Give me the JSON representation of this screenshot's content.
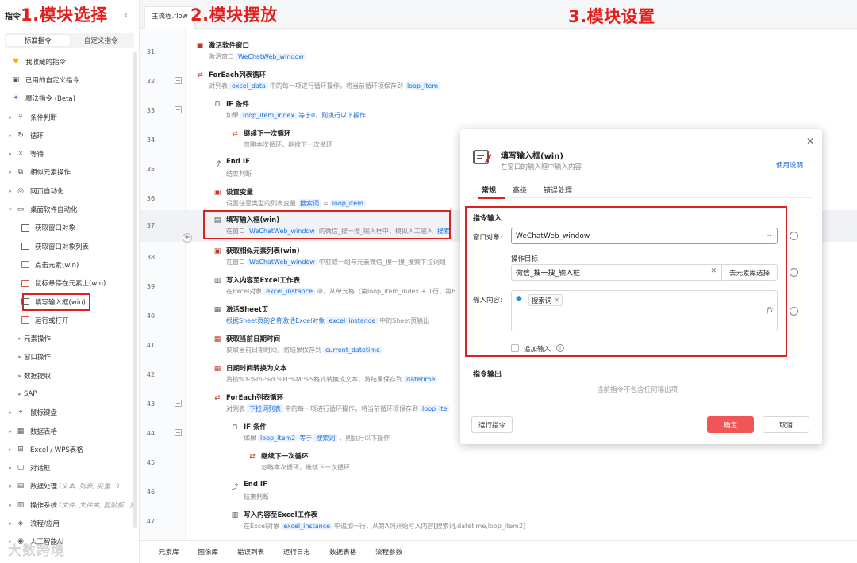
{
  "annotations": {
    "a1": "1.模块选择",
    "a2": "2.模块摆放",
    "a3": "3.模块设置"
  },
  "sidebar": {
    "title": "指令",
    "tabs": [
      "标准指令",
      "自定义指令"
    ],
    "items": [
      {
        "label": "我收藏的指令",
        "icon": "heart-icon"
      },
      {
        "label": "已用的自定义指令",
        "icon": "box-icon"
      },
      {
        "label": "魔法指令 (Beta)",
        "icon": "magic-icon"
      },
      {
        "label": "条件判断",
        "icon": "branch-icon"
      },
      {
        "label": "循环",
        "icon": "loop-icon"
      },
      {
        "label": "等待",
        "icon": "hourglass-icon"
      },
      {
        "label": "相似元素操作",
        "icon": "copy-icon"
      },
      {
        "label": "网页自动化",
        "icon": "globe-icon"
      },
      {
        "label": "桌面软件自动化",
        "icon": "monitor-icon"
      },
      {
        "label": "获取窗口对象",
        "icon": "window-icon"
      },
      {
        "label": "获取窗口对象列表",
        "icon": "window-list-icon"
      },
      {
        "label": "点击元素(win)",
        "icon": "click-icon"
      },
      {
        "label": "鼠标悬停在元素上(win)",
        "icon": "hover-icon"
      },
      {
        "label": "填写输入框(win)",
        "icon": "input-icon"
      },
      {
        "label": "运行或打开",
        "icon": "run-icon"
      },
      {
        "label": "元素操作",
        "icon": ""
      },
      {
        "label": "窗口操作",
        "icon": ""
      },
      {
        "label": "数据提取",
        "icon": ""
      },
      {
        "label": "SAP",
        "icon": ""
      },
      {
        "label": "鼠标键盘",
        "icon": "mouse-icon"
      },
      {
        "label": "数据表格",
        "icon": "table-icon"
      },
      {
        "label": "Excel / WPS表格",
        "icon": "excel-icon"
      },
      {
        "label": "对话框",
        "icon": "dialog-icon"
      },
      {
        "label": "数据处理",
        "hint": "(文本, 列表, 变量...)",
        "icon": "data-icon"
      },
      {
        "label": "操作系统",
        "hint": "(文件, 文件夹, 剪贴板...)",
        "icon": "os-icon"
      },
      {
        "label": "流程/应用",
        "icon": "flow-icon"
      },
      {
        "label": "人工智能AI",
        "icon": "ai-icon"
      }
    ]
  },
  "main": {
    "file_tab": "主流程.flow",
    "rows": [
      {
        "ln": "31",
        "title": "激活软件窗口",
        "desc_pre": "激活窗口",
        "v1": "WeChatWeb_window"
      },
      {
        "ln": "32",
        "title": "ForEach列表循环",
        "desc_pre": "对列表",
        "v1": "excel_data",
        "desc_mid": "中的每一项进行循环操作，将当前循环项保存到",
        "v2": "loop_item"
      },
      {
        "ln": "33",
        "title": "IF 条件",
        "desc_pre": "如果",
        "v1": "loop_item_index",
        "desc_mid": "等于0，则执行以下操作"
      },
      {
        "ln": "34",
        "title": "继续下一次循环",
        "desc_pre": "忽略本次循环，继续下一次循环"
      },
      {
        "ln": "35",
        "title": "End IF",
        "desc_pre": "结束判断"
      },
      {
        "ln": "36",
        "title": "设置变量",
        "desc_pre": "设置任意类型的列表变量",
        "v1": "搜索词",
        "desc_mid": "=",
        "v2": "loop_item"
      },
      {
        "ln": "37",
        "title": "填写输入框(win)",
        "desc_pre": "在窗口",
        "v1": "WeChatWeb_window",
        "desc_mid": "的微信_搜一搜_输入框中，模拟人工输入",
        "v2": "搜索"
      },
      {
        "ln": "38",
        "title": "获取相似元素列表(win)",
        "desc_pre": "在窗口",
        "v1": "WeChatWeb_window",
        "desc_mid": "中获取一组与元素微信_搜一搜_搜索下拉词组"
      },
      {
        "ln": "39",
        "title": "写入内容至Excel工作表",
        "desc_pre": "在Excel对象",
        "v1": "excel_instance",
        "desc_mid": "中，从单元格（第loop_item_index + 1行，第B"
      },
      {
        "ln": "40",
        "title": "激活Sheet页",
        "desc_pre": "根据Sheet页的名称激活Excel对象",
        "v1": "excel_instance",
        "desc_mid": "中的Sheet页输出"
      },
      {
        "ln": "41",
        "title": "获取当前日期时间",
        "desc_pre": "获取当前日期时间，将结果保存到",
        "v1": "current_datetime"
      },
      {
        "ln": "42",
        "title": "日期时间转换为文本",
        "desc_pre": "将按%Y-%m-%d %H:%M:%S格式转换成文本，将结果保存到",
        "v1": "datetime"
      },
      {
        "ln": "43",
        "title": "ForEach列表循环",
        "desc_pre": "对列表",
        "v1": "下拉词列表",
        "desc_mid": "中的每一项进行循环操作，将当前循环项保存到",
        "v2": "loop_ite"
      },
      {
        "ln": "44",
        "title": "IF 条件",
        "desc_pre": "如果",
        "v1": "loop_item2",
        "desc_mid": "等于",
        "v2": "搜索词",
        "desc_post": "，则执行以下操作"
      },
      {
        "ln": "45",
        "title": "继续下一次循环",
        "desc_pre": "忽略本次循环，继续下一次循环"
      },
      {
        "ln": "46",
        "title": "End IF",
        "desc_pre": "结束判断"
      },
      {
        "ln": "47",
        "title": "写入内容至Excel工作表",
        "desc_pre": "在Excel对象",
        "v1": "excel_instance",
        "desc_mid": "中追加一行，从第A列开始写入内容[搜索词,datetime,loop_item2]"
      }
    ],
    "bottom_tabs": [
      "元素库",
      "图像库",
      "错误列表",
      "运行日志",
      "数据表格",
      "流程参数"
    ]
  },
  "modal": {
    "title": "填写输入框(win)",
    "subtitle": "在窗口的输入框中输入内容",
    "help": "使用说明",
    "tabs": [
      "常规",
      "高级",
      "错误处理"
    ],
    "section_input": "指令输入",
    "window_label": "窗口对象:",
    "window_value": "WeChatWeb_window",
    "target_label": "操作目标",
    "target_value": "微信_搜一搜_输入框",
    "target_button": "去元素库选择",
    "content_label": "输入内容:",
    "content_chip": "搜索词",
    "fx": "fx",
    "append_label": "追加输入",
    "section_output": "指令输出",
    "output_empty": "当前指令不包含任何输出项",
    "run_button": "运行指令",
    "ok_button": "确定",
    "cancel_button": "取消"
  },
  "watermark": "大数跨境"
}
